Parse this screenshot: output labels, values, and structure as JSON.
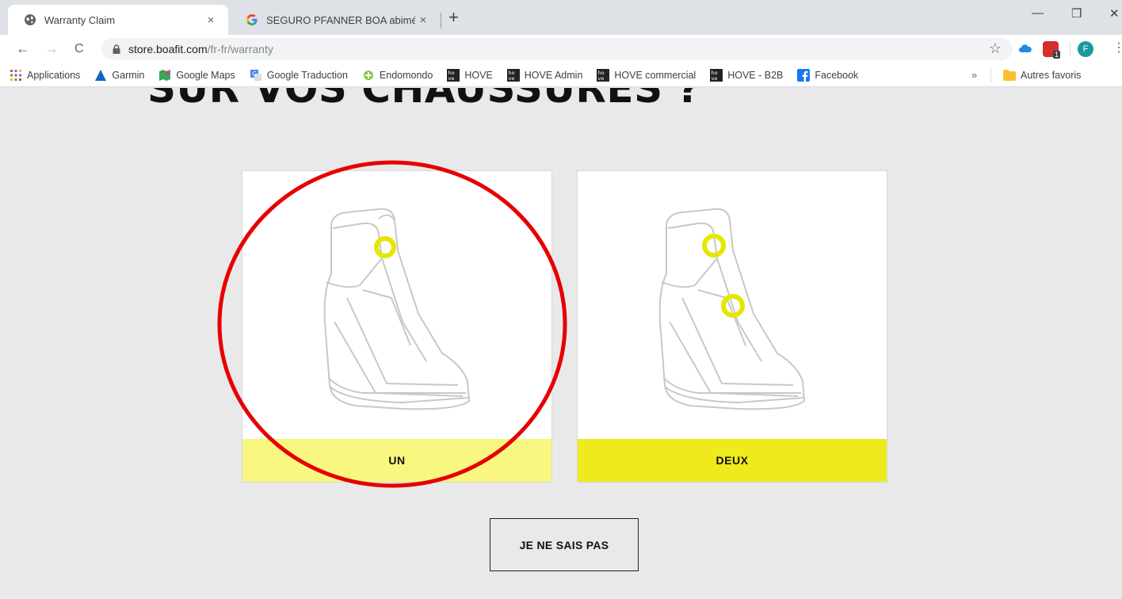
{
  "tabs": [
    {
      "title": "Warranty Claim",
      "close": "×",
      "icon": "globe-icon"
    },
    {
      "title": "SEGURO PFANNER BOA abimé -",
      "close": "×",
      "icon": "google-icon"
    }
  ],
  "new_tab": "+",
  "window_controls": {
    "minimize": "—",
    "restore": "❐",
    "close": "✕"
  },
  "toolbar": {
    "back": "←",
    "forward": "→",
    "reload": "C",
    "url_host": "store.boafit.com",
    "url_path": "/fr-fr/warranty",
    "star": "☆",
    "profile_initial": "F",
    "extension_badge": "1",
    "menu": "⋮"
  },
  "bookmarks": [
    {
      "label": "Applications",
      "icon": "apps-grid-icon"
    },
    {
      "label": "Garmin",
      "icon": "garmin-triangle-icon"
    },
    {
      "label": "Google Maps",
      "icon": "maps-pin-icon"
    },
    {
      "label": "Google Traduction",
      "icon": "translate-icon"
    },
    {
      "label": "Endomondo",
      "icon": "endomondo-icon"
    },
    {
      "label": "HOVE",
      "icon": "hove-logo-icon"
    },
    {
      "label": "HOVE Admin",
      "icon": "hove-logo-icon"
    },
    {
      "label": "HOVE commercial",
      "icon": "hove-logo-icon"
    },
    {
      "label": "HOVE - B2B",
      "icon": "hove-logo-icon"
    },
    {
      "label": "Facebook",
      "icon": "facebook-icon"
    }
  ],
  "bookmarks_more": "»",
  "bookmarks_other": "Autres favoris",
  "page": {
    "heading": "SUR VOS CHAUSSURES ?",
    "options": [
      {
        "label": "UN",
        "dials": 1,
        "bar_color": "#f8f77f"
      },
      {
        "label": "DEUX",
        "dials": 2,
        "bar_color": "#efea1c"
      }
    ],
    "unknown_button": "JE NE SAIS PAS"
  },
  "colors": {
    "annotation_circle": "#e60000",
    "dial_yellow": "#e6e600"
  }
}
